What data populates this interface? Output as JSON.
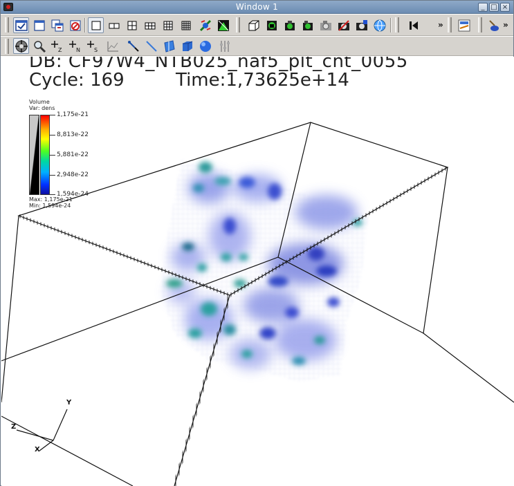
{
  "window": {
    "title": "Window 1",
    "buttons": {
      "minimize": "_",
      "maximize": "□",
      "close": "×"
    }
  },
  "toolbar1": {
    "icons": [
      "active-window-icon",
      "new-window-icon",
      "clone-window-icon",
      "delete-window-icon",
      "layout-1x1-icon",
      "layout-1x2-icon",
      "layout-2x2-icon",
      "layout-2x3-icon",
      "layout-3x3-icon",
      "spin-icon",
      "full-frame-icon",
      "perspective-box-icon",
      "lock-view-icon",
      "lock-time-icon",
      "lock-tools-icon",
      "camera-icon",
      "camera-off-icon",
      "camera-save-icon",
      "globe-icon",
      "play-back-icon",
      "more-icon",
      "color-table-icon",
      "brush-icon",
      "more-icon"
    ]
  },
  "toolbar2": {
    "icons": [
      "navigate-icon",
      "zoom-icon",
      "zone-pick-icon",
      "node-pick-icon",
      "spreadsheet-pick-icon",
      "lineout-icon",
      "point-tool-icon",
      "line-tool-icon",
      "plane-tool-icon",
      "box-tool-icon",
      "sphere-tool-icon",
      "axis-restrict-icon"
    ]
  },
  "annotation": {
    "db": "DB: CF97W4_NTB025_naf5_plt_cnt_0055",
    "cycle": "Cycle: 169",
    "time": "Time:1,73625e+14"
  },
  "legend": {
    "plot_type": "Volume",
    "var": "Var: dens",
    "labels": [
      "1,175e-21",
      "8,813e-22",
      "5,881e-22",
      "2,948e-22",
      "1,594e-24"
    ],
    "max": "Max: 1,175e-21",
    "min": "Min: 1,594e-24",
    "colors": [
      "#ff0000",
      "#ffff00",
      "#50ff20",
      "#00b0ff",
      "#1010a0"
    ]
  },
  "triad": {
    "x": "X",
    "y": "Y",
    "z": "Z"
  }
}
